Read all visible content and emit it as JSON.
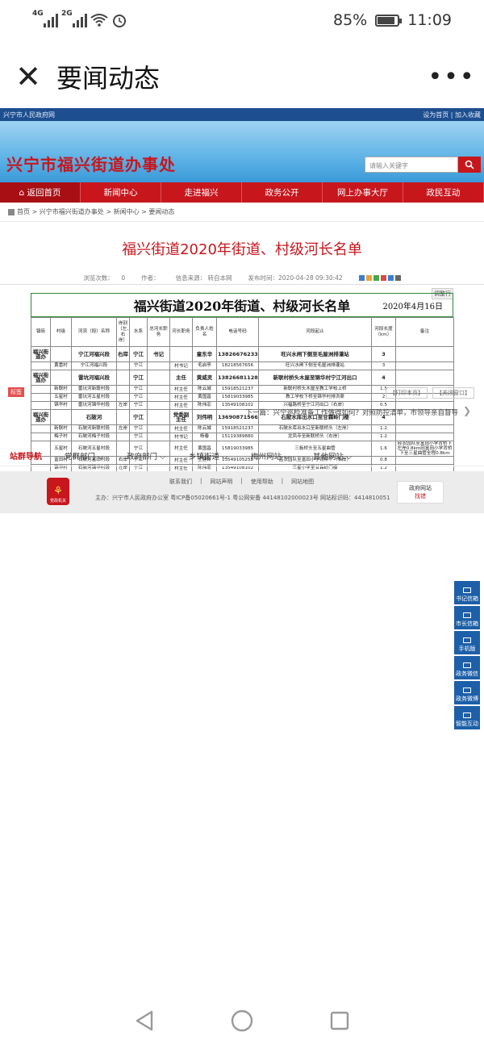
{
  "status": {
    "net1": "4G",
    "net2": "2G",
    "battery": "85%",
    "time": "11:09"
  },
  "appbar": {
    "title": "要闻动态"
  },
  "site": {
    "topline_left": "兴宁市人民政府网",
    "topline_right": "设为首页 | 加入收藏",
    "name": "兴宁市福兴街道办事处",
    "search_placeholder": "请输入关键字",
    "nav": [
      "返回首页",
      "新闻中心",
      "走进福兴",
      "政务公开",
      "网上办事大厅",
      "政民互动"
    ],
    "breadcrumb": "首页 > 兴宁市福兴街道办事处 > 新闻中心 > 要闻动态"
  },
  "article": {
    "title": "福兴街道2020年街道、村级河长名单",
    "meta_views_label": "浏览次数：",
    "meta_views": "0",
    "meta_author_label": "作者：",
    "meta_source": "信息来源：  转自本网",
    "meta_date": "发布时间：2020-04-28 09:30:42"
  },
  "doc": {
    "tag": "调整行",
    "title": "福兴街道2020年街道、村级河长名单",
    "date": "2020年4月16日",
    "headers": [
      "镇街",
      "村级",
      "河流（段）名称",
      "岸别（左、右岸）",
      "水系",
      "总河长职务",
      "河长职务",
      "负责人姓名",
      "电话号码",
      "河段起止",
      "河段长度（km）",
      "备注"
    ],
    "rows": [
      {
        "cells": [
          "福兴街道办",
          "",
          "宁江河福兴段",
          "右岸",
          "宁江",
          "书记",
          "",
          "童东辛",
          "13826676233",
          "旺兴水闸下侧至毛屋洲排灌站",
          "3",
          ""
        ],
        "big": true
      },
      {
        "cells": [
          "",
          "黄畲村",
          "宁江河福兴段",
          "",
          "宁江",
          "",
          "村书记",
          "毛启亭",
          "18218567656",
          "旺兴水闸下侧至毛屋洲排灌站",
          "3",
          ""
        ],
        "big": false
      },
      {
        "cells": [
          "福兴街道办",
          "",
          "雷坑河福兴段",
          "",
          "宁江",
          "",
          "主任",
          "黄威灵",
          "13826681128",
          "新联村桥头木屋至锦华村宁江河出口",
          "4",
          ""
        ],
        "big": true
      },
      {
        "cells": [
          "",
          "新联村",
          "雷坑河新联村段",
          "",
          "宁江",
          "",
          "村主任",
          "陈云城",
          "15918521237",
          "新联村桥头木屋至教工学校上桥",
          "1.5",
          ""
        ],
        "big": false
      },
      {
        "cells": [
          "",
          "五星村",
          "雷坑河五星村段",
          "",
          "宁江",
          "",
          "村主任",
          "黄国昌",
          "15819033985",
          "教工学校下桥至锦华村排洪渠",
          "2",
          ""
        ],
        "big": false
      },
      {
        "cells": [
          "",
          "锦华村",
          "雷坑河锦华村段",
          "左岸",
          "宁江",
          "",
          "村主任",
          "陈伟宏",
          "13549108102",
          "兴福路桥至宁江河出口（右岸）",
          "0.5",
          ""
        ],
        "big": false
      },
      {
        "cells": [
          "福兴街道办",
          "",
          "石陂河",
          "",
          "宁江",
          "",
          "党委副主任",
          "刘伟明",
          "13690871566",
          "石陂水库出水口至甘霖岭门楼",
          "4",
          ""
        ],
        "big": true
      },
      {
        "cells": [
          "",
          "新联村",
          "石陂河新联村段",
          "左岸",
          "宁江",
          "",
          "村主任",
          "陈云城",
          "15918521237",
          "石陂水库出水口至新联桥头（左岸）",
          "1.2",
          ""
        ],
        "big": false
      },
      {
        "cells": [
          "",
          "梅子村",
          "石陂河梅子村段",
          "",
          "宁江",
          "",
          "村书记",
          "杨春",
          "15119389880",
          "龙凤寺至新联桥头（右岸）",
          "1.2",
          ""
        ],
        "big": false
      },
      {
        "cells": [
          "",
          "五星村",
          "石陂河五星村段",
          "",
          "宁江",
          "",
          "村主任",
          "黄国昌",
          "15819033985",
          "三板桥头至五星曲管",
          "1.6",
          "经农园队至富田小学背桥下左岸0.8km田富田小学背桥下至三星曲管全程0.8km"
        ],
        "big": false
      },
      {
        "cells": [
          "",
          "富田村",
          "石陂河富田村段",
          "右岸",
          "宁江",
          "",
          "村主任",
          "王建新",
          "13549105258",
          "蓝农园队至富田小学背桥下（右岸）",
          "0.8",
          ""
        ],
        "big": false
      },
      {
        "cells": [
          "",
          "锦华村",
          "石陂河锦华村段",
          "左岸",
          "宁江",
          "",
          "村主任",
          "陈伟宏",
          "13549108102",
          "三星小学至甘霖岭门楼",
          "1.2",
          ""
        ],
        "big": false
      }
    ]
  },
  "after": {
    "tag": "标签",
    "print": "【打印本页】",
    "close": "【关闭窗口】",
    "next": "下一篇：兴宁巡检准备工作做得如何？对照防控清单，市领导亲自督导"
  },
  "sitenav": {
    "label": "站群导航",
    "items": [
      "党群部门",
      "政府部门",
      "乡镇街道",
      "梅州网站",
      "其他网站"
    ]
  },
  "footer": {
    "links": [
      "联系我们",
      "网站声明",
      "使用帮助",
      "网站地图"
    ],
    "info": "主办：兴宁市人民政府办公室  粤ICP备05020661号-1  粤公网安备 44148102000023号  网站标识码：4414810051",
    "emblem_label": "党政机关",
    "corr_top": "政府网站",
    "corr_bottom": "找错"
  },
  "floatbar": [
    "书记信箱",
    "市长信箱",
    "手机版",
    "政务微信",
    "政务微博",
    "智能互动"
  ],
  "colors": {
    "brand_red": "#c8161d",
    "brand_blue": "#1d4e8f"
  }
}
